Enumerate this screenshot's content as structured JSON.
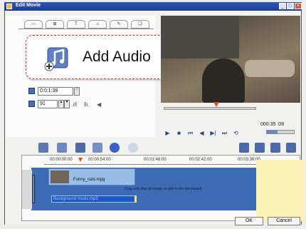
{
  "window": {
    "title": "Edit Movie",
    "minimize": "_",
    "maximize": "□",
    "close": "×"
  },
  "tabs": [
    {
      "label": "▭ ",
      "icon": "title-tab"
    },
    {
      "label": "⊞",
      "icon": "transition-tab"
    },
    {
      "label": "T",
      "icon": "text-tab"
    },
    {
      "label": "♫",
      "icon": "audio-tab"
    },
    {
      "label": "✎",
      "icon": "effects-tab"
    },
    {
      "label": "❑",
      "icon": "overlay-tab"
    }
  ],
  "callout": {
    "label": "Add Audio"
  },
  "duration": {
    "value": "0:0:1:38",
    "unit": "⬦"
  },
  "volume_field": {
    "value": "91"
  },
  "preview": {
    "timecode": "000:35 :08",
    "seek_position": 0.54
  },
  "transport": [
    "▶",
    "■",
    "⏮",
    "◀",
    "▶|",
    "⏭",
    "⟲"
  ],
  "volume_level": 0.4,
  "toolbar": [
    "add-video-icon",
    "add-image-icon",
    "add-text-icon",
    "add-audio-icon",
    "record-icon",
    "settings-icon"
  ],
  "timeline": {
    "ticks": [
      "00:00:00:00",
      "00:00:54:00",
      "00:01:48:00",
      "00:02:42:00",
      "00:03:36:00"
    ],
    "video_clip_name": "Funny_cats.mpg",
    "audio_clip_name": "Background music.mp3",
    "hint": "Drag and drop an image to add to the storyboard"
  },
  "buttons": {
    "ok": "OK",
    "cancel": "Cancel"
  }
}
